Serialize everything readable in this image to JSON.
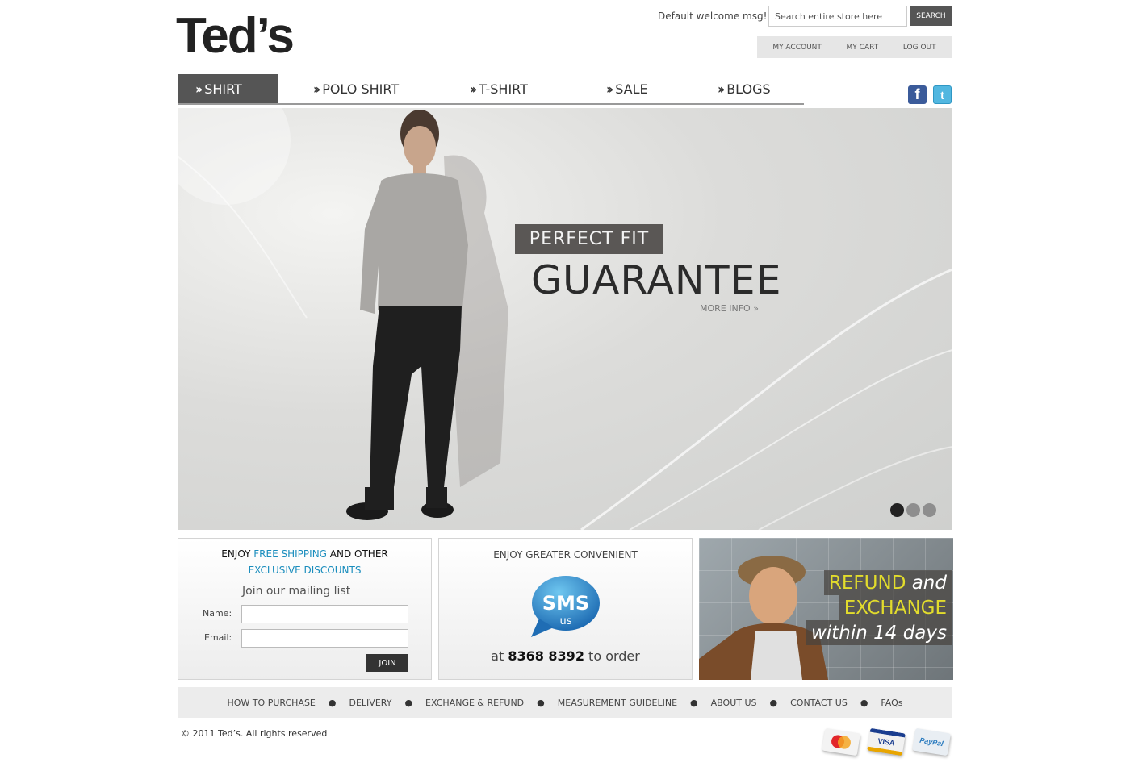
{
  "header": {
    "logo": "Ted’s",
    "welcome": "Default welcome msg!",
    "search_placeholder": "Search entire store here",
    "search_button": "SEARCH",
    "account_links": [
      "MY ACCOUNT",
      "MY CART",
      "LOG OUT"
    ]
  },
  "nav": {
    "items": [
      {
        "label": "SHIRT",
        "active": true
      },
      {
        "label": "POLO SHIRT",
        "active": false
      },
      {
        "label": "T-SHIRT",
        "active": false
      },
      {
        "label": "SALE",
        "active": false
      },
      {
        "label": "BLOGS",
        "active": false
      }
    ]
  },
  "social": {
    "facebook": "f",
    "twitter": "t"
  },
  "hero": {
    "line1": "PERFECT FIT",
    "line2": "GUARANTEE",
    "more": "MORE INFO »",
    "slide_count": 3,
    "active_slide": 1
  },
  "mailing": {
    "line1_a": "ENJOY ",
    "line1_b": "FREE SHIPPING",
    "line1_c": " AND OTHER",
    "line2": "EXCLUSIVE DISCOUNTS",
    "join_title": "Join our mailing list",
    "name_label": "Name:",
    "email_label": "Email:",
    "join_button": "JOIN"
  },
  "sms": {
    "title": "ENJOY GREATER CONVENIENT",
    "badge_top": "SMS",
    "badge_bottom": "us",
    "phone_pre": "at ",
    "phone": "8368 8392",
    "phone_post": " to order"
  },
  "refund": {
    "w1": "REFUND",
    "w2": " and",
    "w3": "EXCHANGE",
    "w4": "within 14 days"
  },
  "footer": {
    "links": [
      "HOW TO PURCHASE",
      "DELIVERY",
      "EXCHANGE & REFUND",
      "MEASUREMENT GUIDELINE",
      "ABOUT US",
      "CONTACT US",
      "FAQs"
    ],
    "copyright": "© 2011 Ted’s. All rights reserved",
    "cards": [
      "MasterCard",
      "VISA",
      "PayPal"
    ]
  },
  "colors": {
    "accent_blue": "#1a8dbd",
    "nav_active": "#555555",
    "refund_yellow": "#e2dc2c"
  }
}
